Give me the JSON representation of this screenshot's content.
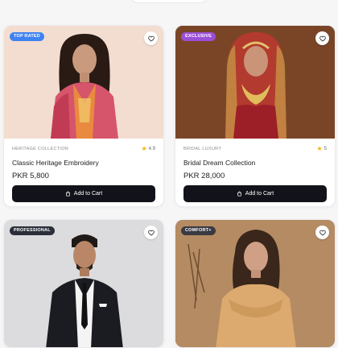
{
  "products": [
    {
      "badge": "TOP RATED",
      "badge_color": "#3f82f0",
      "category": "HERITAGE COLLECTION",
      "rating": "4.9",
      "name": "Classic Heritage Embroidery",
      "price": "PKR 5,800",
      "cart_label": "Add to Cart",
      "favorite_icon": "heart-icon"
    },
    {
      "badge": "EXCLUSIVE",
      "badge_color": "#9b4fd6",
      "category": "BRIDAL LUXURY",
      "rating": "5",
      "name": "Bridal Dream Collection",
      "price": "PKR 28,000",
      "cart_label": "Add to Cart",
      "favorite_icon": "heart-icon"
    },
    {
      "badge": "PROFESSIONAL",
      "badge_color": "#2b2f3a",
      "favorite_icon": "heart-icon"
    },
    {
      "badge": "COMFORT+",
      "badge_color": "#3a3a42",
      "favorite_icon": "heart-icon"
    }
  ],
  "colors": {
    "button_bg": "#12131a",
    "star": "#f5b400",
    "card_bg": "#ffffff"
  }
}
